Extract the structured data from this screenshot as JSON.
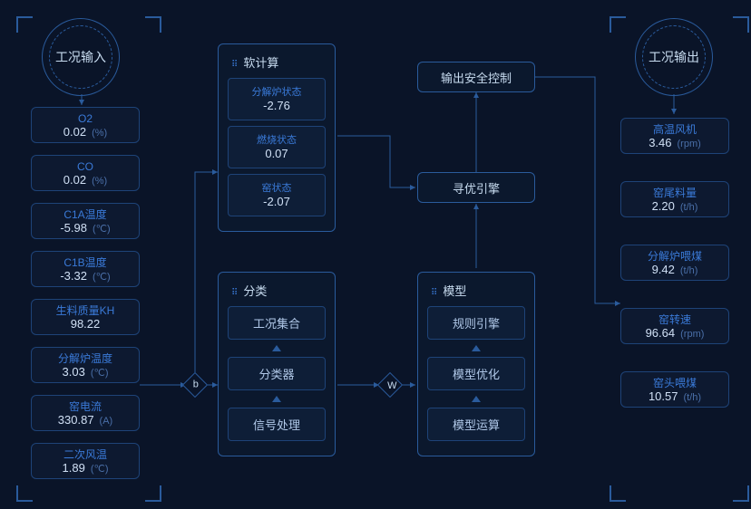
{
  "input_title": "工况输入",
  "output_title": "工况输出",
  "inputs": [
    {
      "label": "O2",
      "value": "0.02",
      "unit": "(%)"
    },
    {
      "label": "CO",
      "value": "0.02",
      "unit": "(%)"
    },
    {
      "label": "C1A温度",
      "value": "-5.98",
      "unit": "(℃)"
    },
    {
      "label": "C1B温度",
      "value": "-3.32",
      "unit": "(℃)"
    },
    {
      "label": "生料质量KH",
      "value": "98.22",
      "unit": ""
    },
    {
      "label": "分解炉温度",
      "value": "3.03",
      "unit": "(℃)"
    },
    {
      "label": "窑电流",
      "value": "330.87",
      "unit": "(A)"
    },
    {
      "label": "二次风温",
      "value": "1.89",
      "unit": "(℃)"
    }
  ],
  "outputs": [
    {
      "label": "高温风机",
      "value": "3.46",
      "unit": "(rpm)"
    },
    {
      "label": "窑尾料量",
      "value": "2.20",
      "unit": "(t/h)"
    },
    {
      "label": "分解炉喂煤",
      "value": "9.42",
      "unit": "(t/h)"
    },
    {
      "label": "窑转速",
      "value": "96.64",
      "unit": "(rpm)"
    },
    {
      "label": "窑头喂煤",
      "value": "10.57",
      "unit": "(t/h)"
    }
  ],
  "soft_title": "软计算",
  "soft": [
    {
      "label": "分解炉状态",
      "value": "-2.76"
    },
    {
      "label": "燃烧状态",
      "value": "0.07"
    },
    {
      "label": "窑状态",
      "value": "-2.07"
    }
  ],
  "classify_title": "分类",
  "classify": [
    "工况集合",
    "分类器",
    "信号处理"
  ],
  "model_title": "模型",
  "model": [
    "规则引擎",
    "模型优化",
    "模型运算"
  ],
  "safety": "输出安全控制",
  "opt_engine": "寻优引擎",
  "junc_b": "b",
  "junc_w": "W"
}
